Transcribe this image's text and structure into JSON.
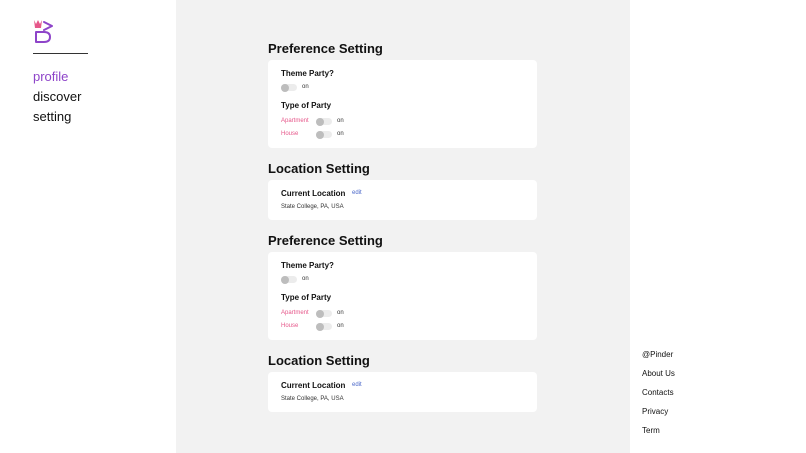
{
  "sidebar": {
    "logo_icon": "pinder-logo-icon",
    "nav": [
      {
        "label": "profile",
        "active": true
      },
      {
        "label": "discover",
        "active": false
      },
      {
        "label": "setting",
        "active": false
      }
    ]
  },
  "sections": [
    {
      "type": "preference",
      "title": "Preference Setting",
      "theme_label": "Theme Party?",
      "theme_toggle_text": "on",
      "type_label": "Type of Party",
      "options": [
        {
          "label": "Apartment",
          "toggle_text": "on"
        },
        {
          "label": "House",
          "toggle_text": "on"
        }
      ]
    },
    {
      "type": "location",
      "title": "Location Setting",
      "current_label": "Current Location",
      "edit_label": "edit",
      "location": "State College, PA, USA"
    },
    {
      "type": "preference",
      "title": "Preference Setting",
      "theme_label": "Theme Party?",
      "theme_toggle_text": "on",
      "type_label": "Type of Party",
      "options": [
        {
          "label": "Apartment",
          "toggle_text": "on"
        },
        {
          "label": "House",
          "toggle_text": "on"
        }
      ]
    },
    {
      "type": "location",
      "title": "Location Setting",
      "current_label": "Current Location",
      "edit_label": "edit",
      "location": "State College, PA, USA"
    }
  ],
  "footer": {
    "brand": "@Pinder",
    "links": [
      "About Us",
      "Contacts",
      "Privacy",
      "Term"
    ]
  },
  "colors": {
    "accent": "#8e44c9",
    "pink": "#e6578a",
    "link": "#4a67c9",
    "main_bg": "#f2f2f2"
  }
}
